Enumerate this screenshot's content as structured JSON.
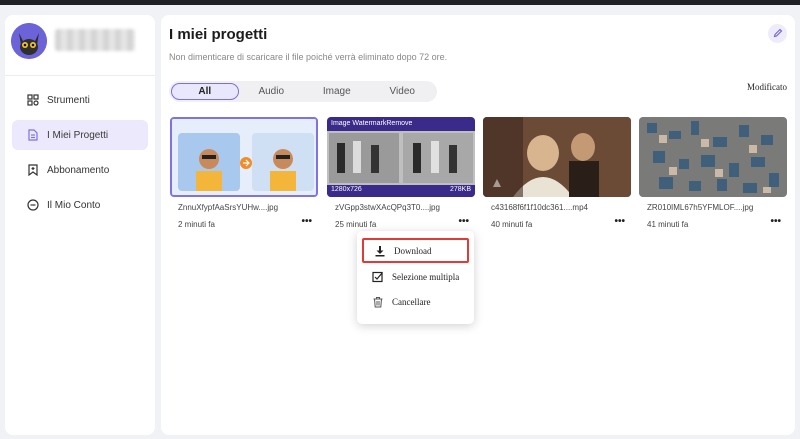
{
  "sidebar": {
    "items": [
      {
        "label": "Strumenti",
        "icon": "grid-icon"
      },
      {
        "label": "I Miei Progetti",
        "icon": "document-icon"
      },
      {
        "label": "Abbonamento",
        "icon": "bookmark-icon"
      },
      {
        "label": "Il Mio Conto",
        "icon": "circle-icon"
      }
    ],
    "active_index": 1
  },
  "main": {
    "title": "I miei progetti",
    "subtitle": "Non dimenticare di scaricare il file poiché verrà eliminato dopo 72 ore.",
    "tabs": [
      "All",
      "Audio",
      "Image",
      "Video"
    ],
    "active_tab": "All",
    "sort_label": "Modificato"
  },
  "projects": [
    {
      "name": "ZnnuXfypfAaSrsYUHw....jpg",
      "time": "2 minuti fa",
      "more": "•••"
    },
    {
      "name": "zVGpp3stwXAcQPq3T0....jpg",
      "time": "25 minuti fa",
      "more": "•••",
      "banner": "Image WatermarkRemove",
      "dims": "1280x726",
      "size": "278KB"
    },
    {
      "name": "c43168f6f1f10dc361....mp4",
      "time": "40 minuti fa",
      "more": "•••"
    },
    {
      "name": "ZR010IML67h5YFMLOF....jpg",
      "time": "41 minuti fa",
      "more": "•••"
    }
  ],
  "context_menu": {
    "items": [
      "Download",
      "Selezione multipla",
      "Cancellare"
    ]
  },
  "colors": {
    "accent": "#7d72e6",
    "highlight": "#e53935",
    "active_nav": "#ebe9fb"
  }
}
